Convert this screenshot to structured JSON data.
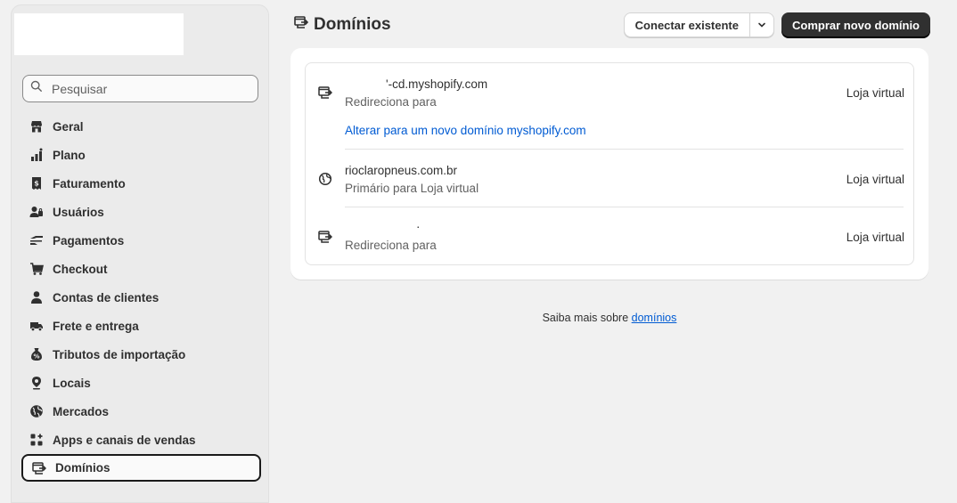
{
  "sidebar": {
    "search_placeholder": "Pesquisar",
    "items": [
      {
        "label": "Geral",
        "icon": "store-icon"
      },
      {
        "label": "Plano",
        "icon": "plan-icon"
      },
      {
        "label": "Faturamento",
        "icon": "billing-icon"
      },
      {
        "label": "Usuários",
        "icon": "users-icon"
      },
      {
        "label": "Pagamentos",
        "icon": "payments-icon"
      },
      {
        "label": "Checkout",
        "icon": "cart-icon"
      },
      {
        "label": "Contas de clientes",
        "icon": "person-icon"
      },
      {
        "label": "Frete e entrega",
        "icon": "truck-icon"
      },
      {
        "label": "Tributos de importação",
        "icon": "duties-icon"
      },
      {
        "label": "Locais",
        "icon": "location-icon"
      },
      {
        "label": "Mercados",
        "icon": "globe-icon"
      },
      {
        "label": "Apps e canais de vendas",
        "icon": "apps-icon"
      },
      {
        "label": "Domínios",
        "icon": "domain-icon",
        "active": true
      }
    ]
  },
  "header": {
    "title": "Domínios",
    "connect_label": "Conectar existente",
    "buy_label": "Comprar novo domínio"
  },
  "domains": [
    {
      "name": "'-cd.myshopify.com",
      "subtitle": "Redireciona para",
      "type": "Loja virtual",
      "link": "Alterar para um novo domínio myshopify.com",
      "icon": "redirect-icon"
    },
    {
      "name": "rioclaropneus.com.br",
      "subtitle": "Primário para Loja virtual",
      "type": "Loja virtual",
      "icon": "globe-icon"
    },
    {
      "name": "·",
      "subtitle": "Redireciona para",
      "type": "Loja virtual",
      "icon": "redirect-icon"
    }
  ],
  "footer": {
    "text": "Saiba mais sobre",
    "link": "domínios"
  },
  "colors": {
    "background": "#f1f1f1",
    "accent_link": "#005bd3",
    "primary_button": "#303030"
  }
}
